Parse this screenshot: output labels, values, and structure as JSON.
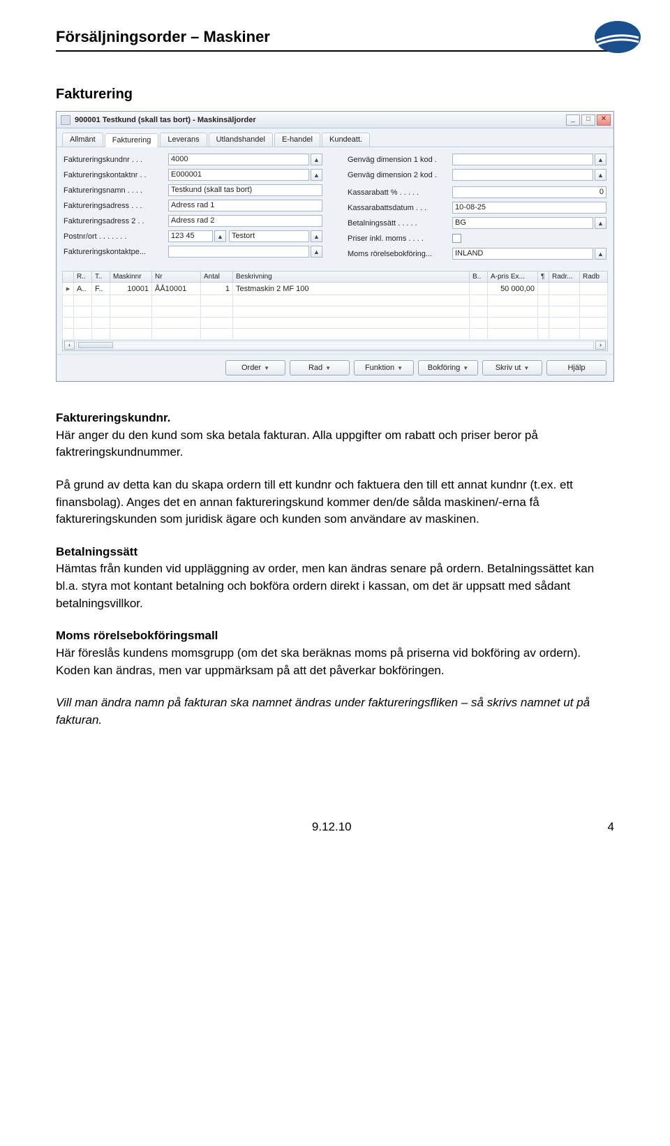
{
  "page": {
    "title": "Försäljningsorder – Maskiner",
    "section": "Fakturering",
    "footer_date": "9.12.10",
    "footer_page": "4"
  },
  "window": {
    "title": "900001 Testkund (skall tas bort) - Maskinsäljorder",
    "tabs": [
      "Allmänt",
      "Fakturering",
      "Leverans",
      "Utlandshandel",
      "E-handel",
      "Kundeatt."
    ],
    "active_tab": 1,
    "left_fields": [
      {
        "label": "Faktureringskundnr .  .  .",
        "value": "4000",
        "lookup": true
      },
      {
        "label": "Faktureringskontaktnr .  .",
        "value": "E000001",
        "lookup": true
      },
      {
        "label": "Faktureringsnamn .  .  .  .",
        "value": "Testkund (skall tas bort)"
      },
      {
        "label": "Faktureringsadress .  .  .",
        "value": "Adress rad 1"
      },
      {
        "label": "Faktureringsadress 2 .  .",
        "value": "Adress rad 2"
      },
      {
        "label": "Postnr/ort  .  .  .  .  .  .  .",
        "value": "123 45",
        "lookup": true,
        "value2": "Testort",
        "lookup2": true
      },
      {
        "label": "Faktureringskontaktpe...",
        "value": "",
        "lookup": true
      }
    ],
    "right_fields": [
      {
        "label": "Genväg dimension 1 kod .",
        "value": "",
        "lookup": true
      },
      {
        "label": "Genväg dimension 2 kod .",
        "value": "",
        "lookup": true
      },
      {
        "label": "Kassarabatt %  .  .  .  .  .",
        "value": "0",
        "align": "right"
      },
      {
        "label": "Kassarabattsdatum .  .  .",
        "value": "10-08-25"
      },
      {
        "label": "Betalningssätt .  .  .  .  .",
        "value": "BG",
        "lookup": true
      },
      {
        "label": "Priser inkl. moms  .  .  .  .",
        "checkbox": true
      },
      {
        "label": "Moms rörelsebokföring...",
        "value": "INLAND",
        "lookup": true
      }
    ],
    "grid": {
      "headers": [
        "",
        "R..",
        "T..",
        "Maskinnr",
        "Nr",
        "Antal",
        "Beskrivning",
        "B..",
        "A-pris Ex...",
        "¶",
        "Radr...",
        "Radb"
      ],
      "row": {
        "marker": "▸",
        "r": "A..",
        "t": "F..",
        "maskinnr": "10001",
        "nr": "ÅÅ10001",
        "antal": "1",
        "besk": "Testmaskin 2 MF 100",
        "b": "",
        "apris": "50 000,00",
        "pil": "",
        "radr": "",
        "radb": ""
      }
    },
    "buttons": [
      "Order",
      "Rad",
      "Funktion",
      "Bokföring",
      "Skriv ut",
      "Hjälp"
    ]
  },
  "body": {
    "p1_title": "Faktureringskundnr.",
    "p1": "Här anger du den kund som ska betala fakturan. Alla uppgifter om rabatt och priser beror på faktreringskundnummer.",
    "p2": "På grund av detta kan du skapa ordern till ett kundnr och faktuera den till ett annat kundnr (t.ex. ett finansbolag). Anges det en annan faktureringskund kommer den/de sålda maskinen/-erna få faktureringskunden som juridisk ägare och kunden som användare av maskinen.",
    "p3_title": "Betalningssätt",
    "p3": "Hämtas från kunden vid uppläggning av order, men kan ändras senare på ordern. Betalningssättet kan bl.a. styra mot kontant betalning och bokföra ordern direkt i kassan, om det är uppsatt med sådant betalningsvillkor.",
    "p4_title": "Moms rörelsebokföringsmall",
    "p4": "Här föreslås kundens momsgrupp (om det ska beräknas moms på priserna vid bokföring av ordern). Koden kan ändras, men var uppmärksam på att det påverkar bokföringen.",
    "p5": "Vill man ändra namn på fakturan ska namnet ändras under faktureringsfliken – så skrivs namnet ut på fakturan."
  }
}
